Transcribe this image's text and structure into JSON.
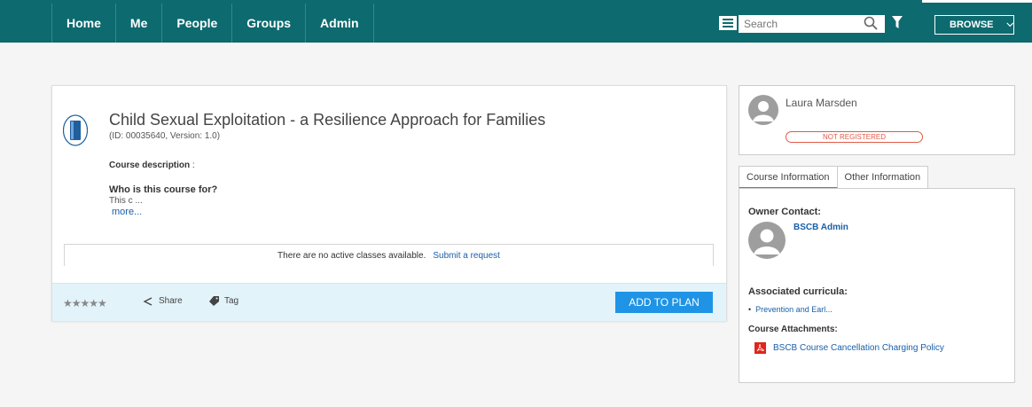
{
  "nav": {
    "items": [
      {
        "label": "Home"
      },
      {
        "label": "Me"
      },
      {
        "label": "People"
      },
      {
        "label": "Groups"
      },
      {
        "label": "Admin"
      }
    ]
  },
  "search": {
    "placeholder": "Search"
  },
  "browse": {
    "label": "BROWSE"
  },
  "course": {
    "title": "Child Sexual Exploitation - a Resilience Approach for Families",
    "id_line": "(ID: 00035640, Version: 1.0)",
    "description_label": "Course description",
    "description_sep": " :",
    "who_heading": "Who is this course for?",
    "snippet": "This c ...",
    "more_link": "more...",
    "no_classes_text": "There are no active classes available.",
    "submit_request": "Submit a request",
    "rating": 0,
    "stars": "★★★★★",
    "share_label": "Share",
    "tag_label": "Tag",
    "add_to_plan": "ADD TO PLAN"
  },
  "user": {
    "name": "Laura Marsden",
    "status": "NOT REGISTERED"
  },
  "tabs": [
    {
      "label": "Course Information",
      "active": true
    },
    {
      "label": "Other Information",
      "active": false
    }
  ],
  "info": {
    "owner_label": "Owner Contact:",
    "owner_name": "BSCB Admin",
    "curricula_label": "Associated curricula:",
    "curricula": [
      {
        "label": "Prevention and Earl..."
      }
    ],
    "attachments_label": "Course Attachments:",
    "attachments": [
      {
        "label": "BSCB Course Cancellation Charging Policy"
      }
    ]
  },
  "colors": {
    "nav_bg": "#0d6a6f",
    "primary_button": "#1f94e6",
    "link": "#1a5fa8",
    "status_badge": "#e05a47",
    "footer_bg": "#e3f3fa"
  },
  "icons": [
    "menu-icon",
    "search-icon",
    "filter-icon",
    "chevron-down-icon",
    "book-icon",
    "share-icon",
    "tag-icon",
    "avatar-icon",
    "pdf-icon"
  ]
}
